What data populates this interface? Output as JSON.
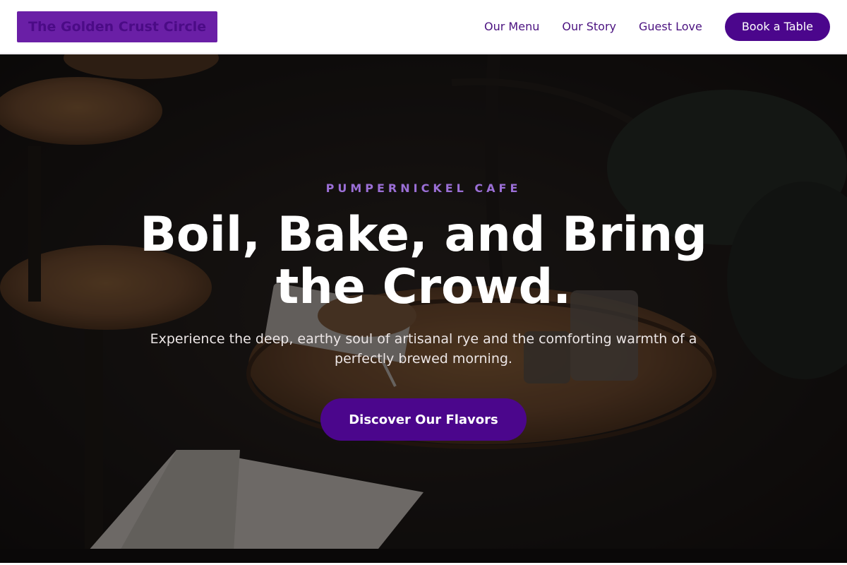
{
  "header": {
    "brand": "The Golden Crust Circle",
    "nav": [
      "Our Menu",
      "Our Story",
      "Guest Love"
    ],
    "cta_label": "Book a Table"
  },
  "hero": {
    "eyebrow": "PUMPERNICKEL CAFE",
    "headline": "Boil, Bake, and Bring the Crowd.",
    "subtext": "Experience the deep, earthy soul of artisanal rye and the comforting warmth of a perfectly brewed morning.",
    "cta_label": "Discover Our Flavors"
  },
  "colors": {
    "brand_purple": "#4b068c",
    "brand_box": "#6a1fa6",
    "eyebrow": "#9b6fd6"
  }
}
